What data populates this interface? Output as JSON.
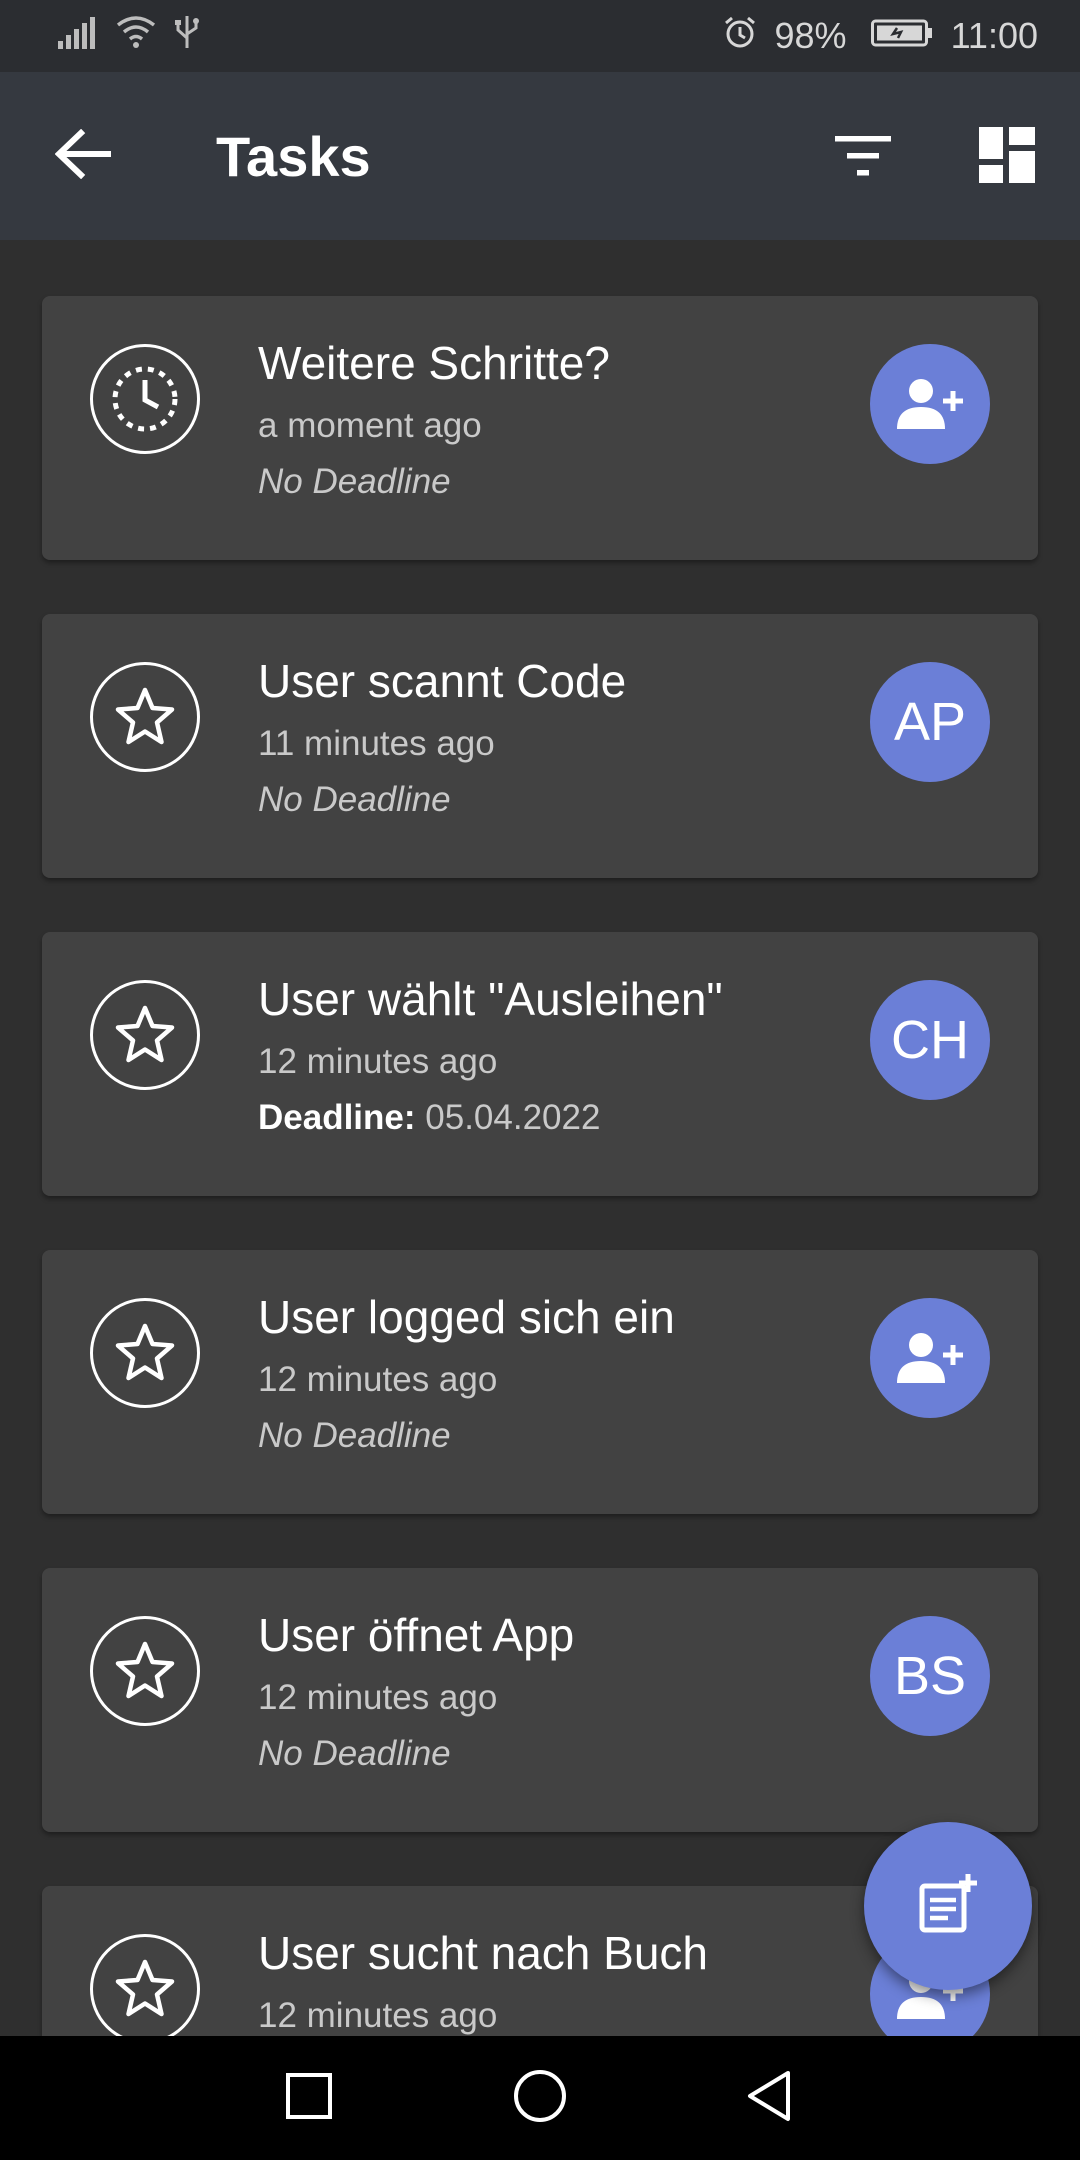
{
  "status_bar": {
    "battery": "98%",
    "time": "11:00",
    "icons": [
      "signal-icon",
      "wifi-icon",
      "usb-icon",
      "alarm-icon",
      "battery-icon"
    ]
  },
  "app_bar": {
    "title": "Tasks",
    "icons": [
      "back-arrow-icon",
      "filter-icon",
      "dashboard-icon"
    ]
  },
  "tasks": [
    {
      "title": "Weitere Schritte?",
      "time": "a moment ago",
      "deadline_text": "No Deadline",
      "deadline_label": "",
      "deadline_date": "",
      "status_icon": "clock-icon",
      "assignee": "",
      "assignee_icon": "add-user-icon"
    },
    {
      "title": "User scannt Code",
      "time": "11 minutes ago",
      "deadline_text": "No Deadline",
      "deadline_label": "",
      "deadline_date": "",
      "status_icon": "star-icon",
      "assignee": "AP",
      "assignee_icon": ""
    },
    {
      "title": "User wählt \"Ausleihen\"",
      "time": "12 minutes ago",
      "deadline_text": "",
      "deadline_label": "Deadline:",
      "deadline_date": "05.04.2022",
      "status_icon": "star-icon",
      "assignee": "CH",
      "assignee_icon": ""
    },
    {
      "title": "User logged sich ein",
      "time": "12 minutes ago",
      "deadline_text": "No Deadline",
      "deadline_label": "",
      "deadline_date": "",
      "status_icon": "star-icon",
      "assignee": "",
      "assignee_icon": "add-user-icon"
    },
    {
      "title": "User öffnet App",
      "time": "12 minutes ago",
      "deadline_text": "No Deadline",
      "deadline_label": "",
      "deadline_date": "",
      "status_icon": "star-icon",
      "assignee": "BS",
      "assignee_icon": ""
    },
    {
      "title": "User sucht nach Buch",
      "time": "12 minutes ago",
      "deadline_text": "",
      "deadline_label": "",
      "deadline_date": "",
      "status_icon": "star-icon",
      "assignee": "",
      "assignee_icon": "add-user-icon"
    }
  ],
  "fab": {
    "icon": "add-note-icon"
  },
  "nav_bar": {
    "icons": [
      "recents-icon",
      "home-icon",
      "back-icon"
    ]
  },
  "colors": {
    "accent": "#6b7fd7",
    "card": "#424242",
    "background": "#2f2f2f",
    "app_bar": "#353940"
  }
}
